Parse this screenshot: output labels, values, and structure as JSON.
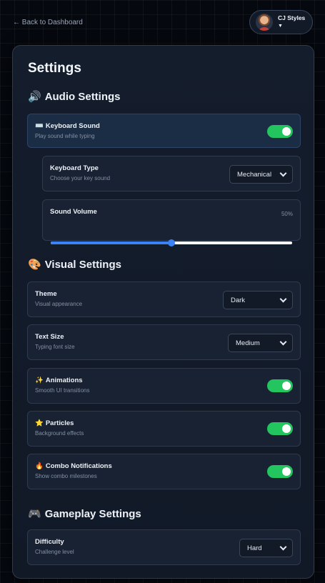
{
  "nav": {
    "back_label": "← Back to Dashboard"
  },
  "user": {
    "name": "CJ Styles",
    "caret": "▼"
  },
  "page": {
    "title": "Settings"
  },
  "sections": {
    "audio": {
      "emoji": "🔊",
      "title": "Audio Settings"
    },
    "visual": {
      "emoji": "🎨",
      "title": "Visual Settings"
    },
    "gameplay": {
      "emoji": "🎮",
      "title": "Gameplay Settings"
    }
  },
  "audio": {
    "keyboard_sound": {
      "emoji": "⌨️",
      "title": "Keyboard Sound",
      "subtitle": "Play sound while typing",
      "enabled": true
    },
    "keyboard_type": {
      "title": "Keyboard Type",
      "subtitle": "Choose your key sound",
      "value": "Mechanical"
    },
    "volume": {
      "title": "Sound Volume",
      "value_text": "50%",
      "value": 0.5
    }
  },
  "visual": {
    "theme": {
      "title": "Theme",
      "subtitle": "Visual appearance",
      "value": "Dark"
    },
    "text_size": {
      "title": "Text Size",
      "subtitle": "Typing font size",
      "value": "Medium"
    },
    "animations": {
      "emoji": "✨",
      "title": "Animations",
      "subtitle": "Smooth UI transitions",
      "enabled": true
    },
    "particles": {
      "emoji": "⭐",
      "title": "Particles",
      "subtitle": "Background effects",
      "enabled": true
    },
    "combo": {
      "emoji": "🔥",
      "title": "Combo Notifications",
      "subtitle": "Show combo milestones",
      "enabled": true
    }
  },
  "gameplay": {
    "difficulty": {
      "title": "Difficulty",
      "subtitle": "Challenge level",
      "value": "Hard"
    }
  },
  "colors": {
    "accent_blue": "#3b82f6",
    "toggle_on": "#22c55e",
    "panel_bg": "#141d2c"
  },
  "icons": {
    "user_avatar": "avatar-icon",
    "select_chevron": "chevron-down-icon"
  }
}
